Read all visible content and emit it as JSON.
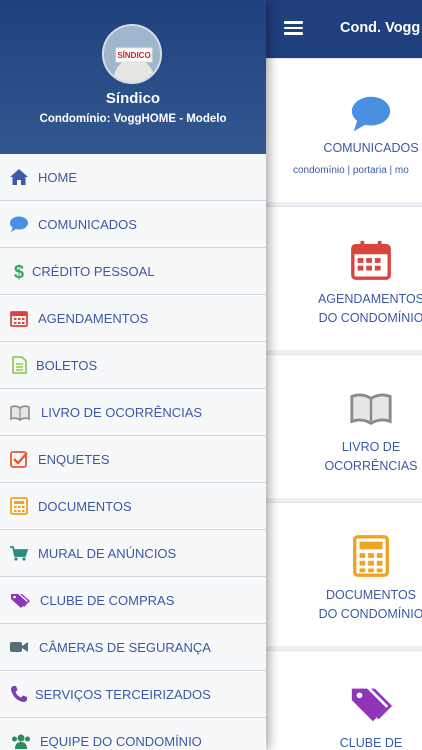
{
  "drawer": {
    "user_name": "Síndico",
    "condo_line": "Condomínio: VoggHOME - Modelo",
    "avatar_text": "SÍNDICO",
    "items": [
      {
        "label": "HOME",
        "icon": "home-icon",
        "color": "#3c5aa6"
      },
      {
        "label": "COMUNICADOS",
        "icon": "chat-bubble-icon",
        "color": "#4a90e2"
      },
      {
        "label": "CRÉDITO PESSOAL",
        "icon": "dollar-icon",
        "color": "#3aa35c"
      },
      {
        "label": "AGENDAMENTOS",
        "icon": "calendar-icon",
        "color": "#d9453d"
      },
      {
        "label": "BOLETOS",
        "icon": "document-icon",
        "color": "#8bc34a"
      },
      {
        "label": "LIVRO DE OCORRÊNCIAS",
        "icon": "book-icon",
        "color": "#8a8a8a"
      },
      {
        "label": "ENQUETES",
        "icon": "checkbox-icon",
        "color": "#e8572f"
      },
      {
        "label": "DOCUMENTOS",
        "icon": "calculator-icon",
        "color": "#eea321"
      },
      {
        "label": "MURAL DE ANÚNCIOS",
        "icon": "cart-icon",
        "color": "#2e8b80"
      },
      {
        "label": "CLUBE DE COMPRAS",
        "icon": "tags-icon",
        "color": "#8e35b8"
      },
      {
        "label": "CÂMERAS DE SEGURANÇA",
        "icon": "video-camera-icon",
        "color": "#546e7a"
      },
      {
        "label": "SERVIÇOS TERCEIRIZADOS",
        "icon": "phone-icon",
        "color": "#7b3fb0"
      },
      {
        "label": "EQUIPE DO CONDOMÍNIO",
        "icon": "users-icon",
        "color": "#2e8b57"
      }
    ]
  },
  "topbar": {
    "title": "Cond. Vogg"
  },
  "cards": [
    {
      "line1": "COMUNICADOS",
      "line2": "",
      "sub": "condomínio | portaria | mo",
      "icon": "chat-bubble-icon",
      "color": "#4a90e2"
    },
    {
      "line1": "AGENDAMENTOS",
      "line2": "DO CONDOMÍNIO",
      "sub": "",
      "icon": "calendar-icon",
      "color": "#d9453d"
    },
    {
      "line1": "LIVRO DE",
      "line2": "OCORRÊNCIAS",
      "sub": "",
      "icon": "book-icon",
      "color": "#8a8a8a"
    },
    {
      "line1": "DOCUMENTOS",
      "line2": "DO CONDOMÍNIO",
      "sub": "",
      "icon": "calculator-icon",
      "color": "#eea321"
    },
    {
      "line1": "CLUBE DE",
      "line2": "",
      "sub": "",
      "icon": "tags-icon",
      "color": "#8e35b8"
    }
  ]
}
